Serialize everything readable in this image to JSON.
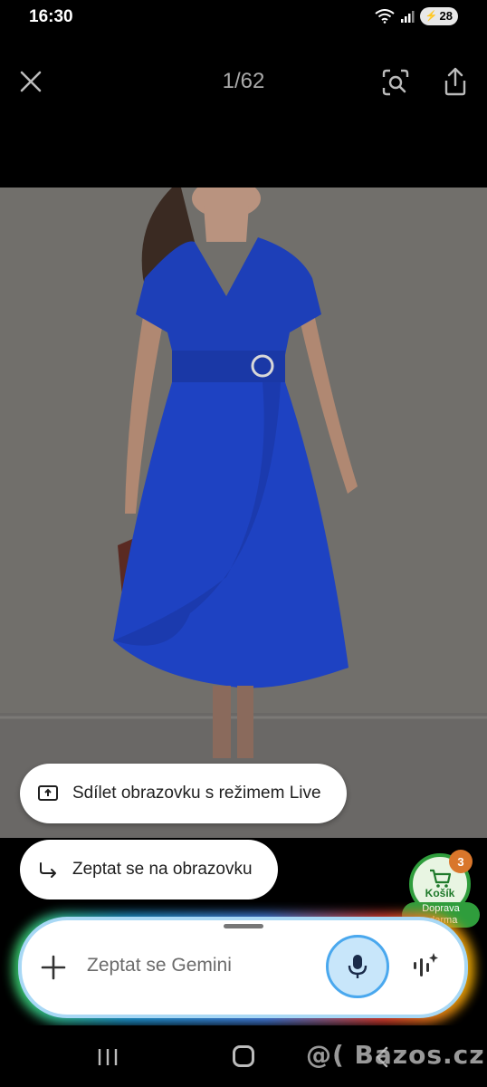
{
  "status_bar": {
    "time": "16:30",
    "battery": "28",
    "icons": [
      "wifi-icon",
      "signal-icon",
      "battery-icon"
    ]
  },
  "viewer": {
    "counter": "1/62",
    "actions": [
      "close-icon",
      "lens-search-icon",
      "share-icon"
    ]
  },
  "photo": {
    "subject": "blue-dress-product-photo"
  },
  "gemini_popup": {
    "share_live_label": "Sdílet obrazovku s režimem Live",
    "ask_screen_label": "Zeptat se na obrazovku"
  },
  "cart": {
    "label": "Košík",
    "count": "3",
    "shipping_label_line1": "Doprava",
    "shipping_label_line2": "zdarma"
  },
  "gemini_bar": {
    "placeholder": "Zeptat se Gemini",
    "buttons": [
      "plus-icon",
      "microphone-icon",
      "gemini-live-icon"
    ]
  },
  "nav_bar": {
    "buttons": [
      "recents-icon",
      "home-icon",
      "back-icon"
    ]
  },
  "watermark": "@( Bazos.cz",
  "colors": {
    "dress": "#1d3fb8",
    "background_wall": "#6f6e6c",
    "gemini_mic_fill": "#c8e6fa",
    "cart_green": "#2f9d3c",
    "cart_badge": "#d9762b"
  }
}
